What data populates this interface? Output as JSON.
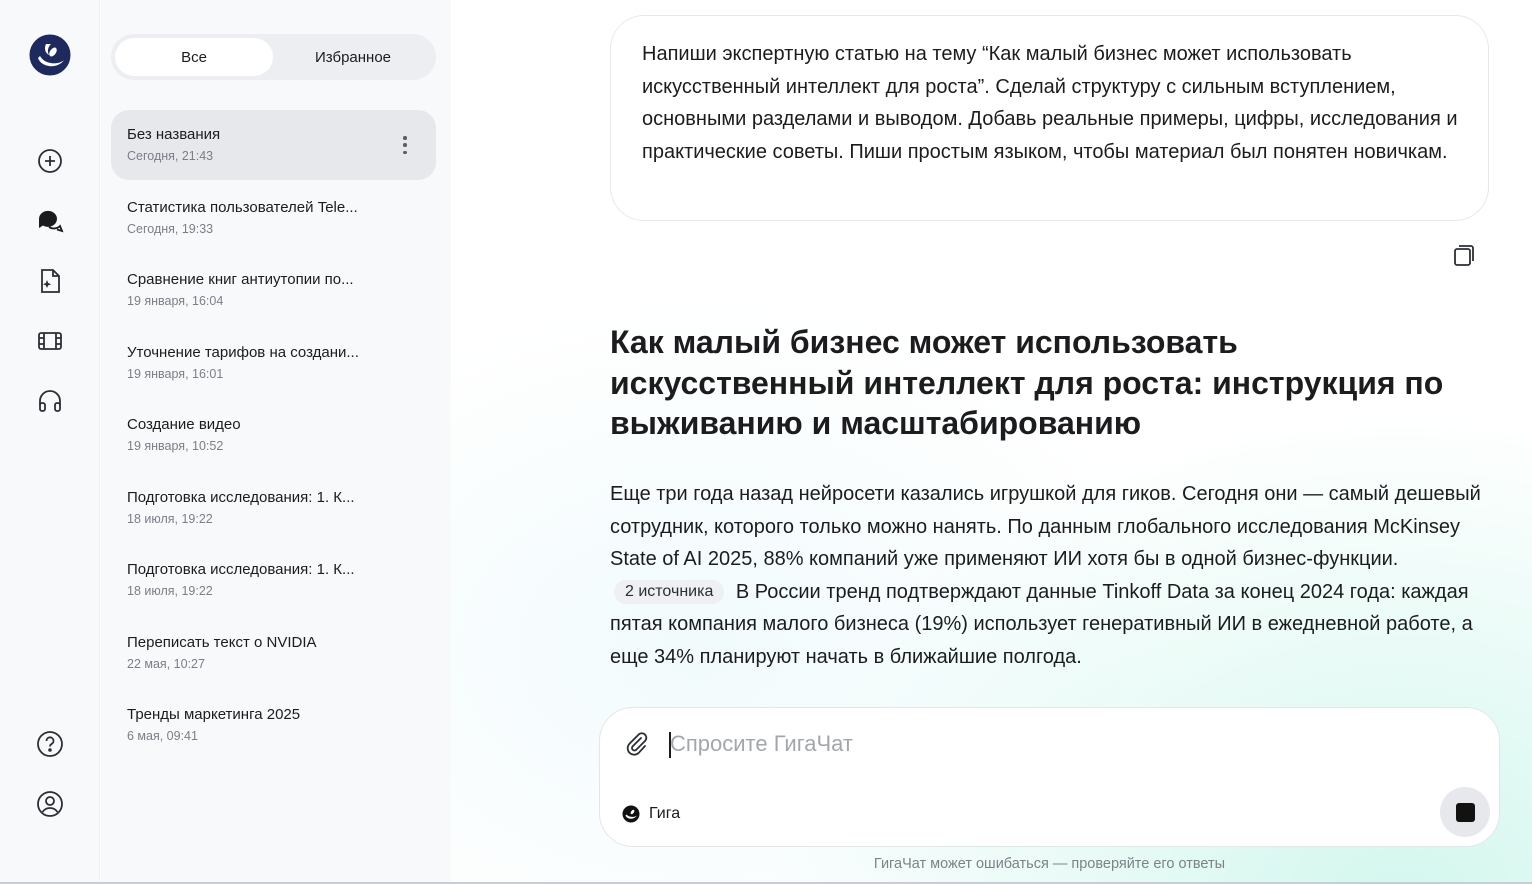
{
  "sidebar": {
    "logo": "gigachat-logo",
    "rail_icons": [
      "new-chat-icon",
      "chats-icon",
      "files-icon",
      "video-icon",
      "audio-icon",
      "help-icon",
      "profile-icon"
    ]
  },
  "chat_list": {
    "tabs": [
      {
        "label": "Все",
        "active": true
      },
      {
        "label": "Избранное",
        "active": false
      }
    ],
    "items": [
      {
        "title": "Без названия",
        "date": "Сегодня, 21:43",
        "selected": true
      },
      {
        "title": "Статистика пользователей Tele...",
        "date": "Сегодня, 19:33"
      },
      {
        "title": "Сравнение книг антиутопии по...",
        "date": "19 января, 16:04"
      },
      {
        "title": "Уточнение тарифов на создани...",
        "date": "19 января, 16:01"
      },
      {
        "title": "Создание видео",
        "date": "19 января, 10:52"
      },
      {
        "title": "Подготовка исследования: 1. К...",
        "date": "18 июля, 19:22"
      },
      {
        "title": "Подготовка исследования: 1. К...",
        "date": "18 июля, 19:22"
      },
      {
        "title": "Переписать текст о NVIDIA",
        "date": "22 мая, 10:27"
      },
      {
        "title": "Тренды маркетинга 2025",
        "date": "6 мая, 09:41"
      }
    ]
  },
  "conversation": {
    "user_message": "Напиши экспертную статью на тему “Как малый бизнес может использовать искусственный интеллект для роста”. Сделай структуру с сильным вступлением, основными разделами и выводом. Добавь реальные примеры, цифры, исследования и практические советы. Пиши простым языком, чтобы материал был понятен новичкам.",
    "answer_title": "Как малый бизнес может использовать искусственный интеллект для роста: инструкция по выживанию и масштабированию",
    "answer_part1": "Еще три года назад нейросети казались игрушкой для гиков. Сегодня они — самый дешевый сотрудник, которого только можно нанять. По данным глобального исследования McKinsey State of AI 2025, 88% компаний уже применяют ИИ хотя бы в одной бизнес-функции.",
    "sources_chip": "2 источника",
    "answer_part2": "В России тренд подтверждают данные Tinkoff Data за конец 2024 года: каждая пятая компания малого бизнеса (19%) использует генеративный ИИ в ежедневной работе, а еще 34% планируют начать в ближайшие полгода."
  },
  "composer": {
    "placeholder": "Спросите ГигаЧат",
    "model_label": "Гига"
  },
  "footer": {
    "disclaimer": "ГигаЧат может ошибаться — проверяйте его ответы"
  }
}
